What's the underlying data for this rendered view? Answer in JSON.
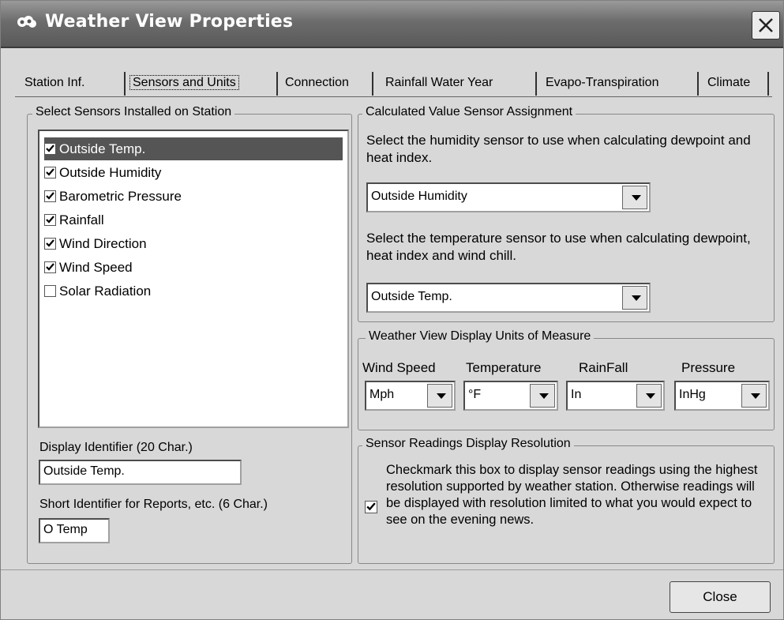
{
  "window": {
    "title": "Weather View Properties"
  },
  "tabs": [
    {
      "label": "Station Inf.",
      "accel_index": 8
    },
    {
      "label": "Sensors and Units",
      "active": true
    },
    {
      "label": "Connection"
    },
    {
      "label": "Rainfall Water Year"
    },
    {
      "label": "Evapo-Transpiration"
    },
    {
      "label": "Climate"
    }
  ],
  "sensors_group": {
    "label": "Select Sensors Installed on Station",
    "items": [
      {
        "label": "Outside Temp.",
        "checked": true,
        "selected": true
      },
      {
        "label": "Outside Humidity",
        "checked": true
      },
      {
        "label": "Barometric Pressure",
        "checked": true
      },
      {
        "label": "Rainfall",
        "checked": true
      },
      {
        "label": "Wind Direction",
        "checked": true
      },
      {
        "label": "Wind Speed",
        "checked": true
      },
      {
        "label": "Solar Radiation",
        "checked": false
      }
    ],
    "display_identifier_label": "Display Identifier (20 Char.)",
    "display_identifier_value": "Outside Temp.",
    "short_identifier_label": "Short Identifier for Reports, etc. (6 Char.)",
    "short_identifier_value": "O Temp"
  },
  "calc_group": {
    "label": "Calculated Value Sensor Assignment",
    "humidity_text": "Select the humidity sensor to use when calculating dewpoint and heat index.",
    "humidity_value": "Outside Humidity",
    "temperature_text": "Select the temperature sensor to use when calculating dewpoint, heat index and wind chill.",
    "temperature_value": "Outside Temp."
  },
  "units_group": {
    "label": "Weather View Display Units of Measure",
    "wind_speed_label": "Wind Speed",
    "wind_speed_value": "Mph",
    "temperature_label": "Temperature",
    "temperature_value": "°F",
    "rainfall_label": "RainFall",
    "rainfall_value": "In",
    "pressure_label": "Pressure",
    "pressure_value": "InHg"
  },
  "resolution_group": {
    "label": "Sensor Readings Display Resolution",
    "checked": true,
    "text": "Checkmark this box to display sensor readings using the highest resolution supported by weather station. Otherwise readings will be displayed with resolution limited to what you would expect to see on the evening news."
  },
  "close_button": "Close",
  "close_x_icon": "close-icon"
}
